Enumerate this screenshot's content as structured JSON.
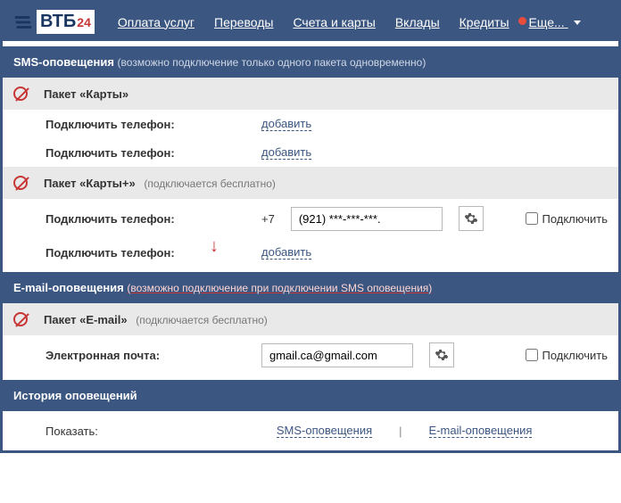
{
  "logo": {
    "text": "ВТБ",
    "suffix": "24"
  },
  "nav": {
    "items": [
      "Оплата услуг",
      "Переводы",
      "Счета и карты",
      "Вклады",
      "Кредиты"
    ],
    "more": "Еще..."
  },
  "sms": {
    "title": "SMS-оповещения",
    "note": "(возможно подключение только одного пакета одновременно)",
    "pkg1": {
      "title": "Пакет «Карты»",
      "label_phone": "Подключить телефон:",
      "add": "добавить"
    },
    "pkg2": {
      "title": "Пакет «Карты+»",
      "note": "(подключается бесплатно)",
      "label_phone": "Подключить телефон:",
      "prefix": "+7",
      "value": "(921) ***-***-***.",
      "add": "добавить",
      "connect": "Подключить"
    }
  },
  "email": {
    "title": "E-mail-оповещения",
    "note": "(возможно подключение при подключении SMS оповещения)",
    "pkg": {
      "title": "Пакет «E-mail»",
      "note": "(подключается бесплатно)",
      "label": "Электронная почта:",
      "value": "gmail.ca@gmail.com",
      "connect": "Подключить"
    }
  },
  "history": {
    "title": "История оповещений",
    "show": "Показать:",
    "sms": "SMS-оповещения",
    "email": "E-mail-оповещения"
  }
}
